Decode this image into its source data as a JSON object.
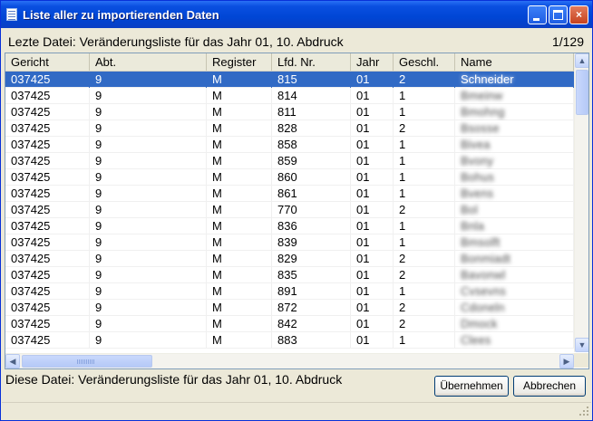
{
  "window": {
    "title": "Liste aller zu importierenden Daten",
    "controls": {
      "minimize": "minimize-icon",
      "maximize": "maximize-icon",
      "close": "×"
    }
  },
  "last_file_label": "Lezte Datei: Veränderungsliste für das Jahr 01, 10. Abdruck",
  "record_counter": "1/129",
  "table": {
    "columns": [
      "Gericht",
      "Abt.",
      "Register",
      "Lfd. Nr.",
      "Jahr",
      "Geschl.",
      "Name"
    ],
    "rows": [
      [
        "037425",
        "9",
        "M",
        "815",
        "01",
        "2",
        "Schneider"
      ],
      [
        "037425",
        "9",
        "M",
        "814",
        "01",
        "1",
        "Bmeinw"
      ],
      [
        "037425",
        "9",
        "M",
        "811",
        "01",
        "1",
        "Bmohng"
      ],
      [
        "037425",
        "9",
        "M",
        "828",
        "01",
        "2",
        "Bsosse"
      ],
      [
        "037425",
        "9",
        "M",
        "858",
        "01",
        "1",
        "Bivea"
      ],
      [
        "037425",
        "9",
        "M",
        "859",
        "01",
        "1",
        "Bvony"
      ],
      [
        "037425",
        "9",
        "M",
        "860",
        "01",
        "1",
        "Bohus"
      ],
      [
        "037425",
        "9",
        "M",
        "861",
        "01",
        "1",
        "Bvens"
      ],
      [
        "037425",
        "9",
        "M",
        "770",
        "01",
        "2",
        "Bol"
      ],
      [
        "037425",
        "9",
        "M",
        "836",
        "01",
        "1",
        "Bnla"
      ],
      [
        "037425",
        "9",
        "M",
        "839",
        "01",
        "1",
        "Bmsolft"
      ],
      [
        "037425",
        "9",
        "M",
        "829",
        "01",
        "2",
        "Bonmiadt"
      ],
      [
        "037425",
        "9",
        "M",
        "835",
        "01",
        "2",
        "Bavonwl"
      ],
      [
        "037425",
        "9",
        "M",
        "891",
        "01",
        "1",
        "Cvsevns"
      ],
      [
        "037425",
        "9",
        "M",
        "872",
        "01",
        "2",
        "Cdoneln"
      ],
      [
        "037425",
        "9",
        "M",
        "842",
        "01",
        "2",
        "Dmock"
      ],
      [
        "037425",
        "9",
        "M",
        "883",
        "01",
        "1",
        "Clees"
      ]
    ],
    "selected_row": 0
  },
  "scrollbars": {
    "up": "▲",
    "down": "▼",
    "left": "◀",
    "right": "▶"
  },
  "this_file_label": "Diese Datei: Veränderungsliste für das Jahr 01, 10. Abdruck",
  "buttons": {
    "apply": "Übernehmen",
    "cancel": "Abbrechen"
  },
  "colors": {
    "title_bar": "#0a4fe0",
    "selection": "#316ac5",
    "dialog_bg": "#ece9d8"
  }
}
